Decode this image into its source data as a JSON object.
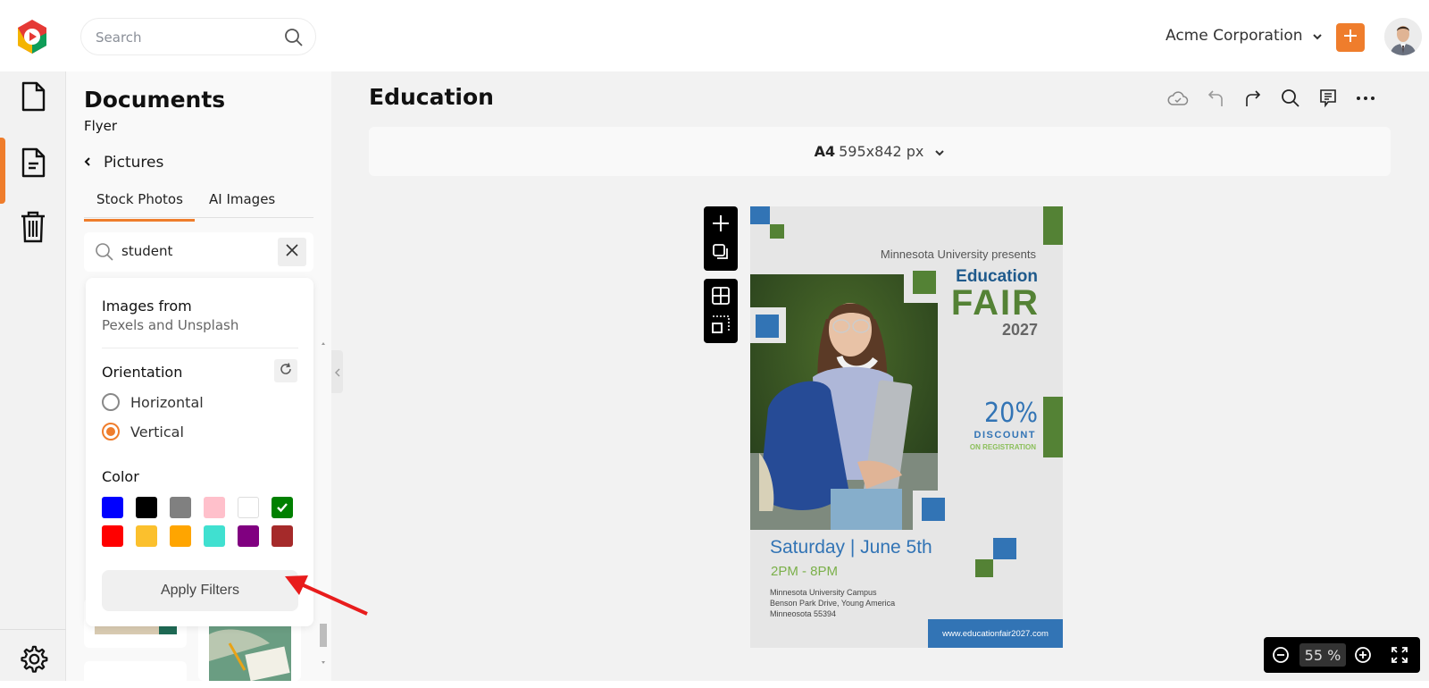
{
  "header": {
    "search_placeholder": "Search",
    "organization": "Acme Corporation",
    "add_label": "+"
  },
  "rail": {
    "items": [
      {
        "name": "documents",
        "icon": "file-icon"
      },
      {
        "name": "templates",
        "icon": "file-text-icon",
        "active": true
      },
      {
        "name": "trash",
        "icon": "trash-icon"
      }
    ],
    "settings_icon": "gear-icon"
  },
  "panel": {
    "title": "Documents",
    "subtitle": "Flyer",
    "back_label": "Pictures",
    "tabs": [
      {
        "label": "Stock Photos",
        "active": true
      },
      {
        "label": "AI Images",
        "active": false
      }
    ],
    "search_value": "student"
  },
  "filters": {
    "source_label": "Images from",
    "source_value": "Pexels and Unsplash",
    "orientation_label": "Orientation",
    "orientation_options": [
      {
        "label": "Horizontal",
        "selected": false
      },
      {
        "label": "Vertical",
        "selected": true
      }
    ],
    "color_label": "Color",
    "colors": [
      {
        "name": "blue",
        "hex": "#0000ff",
        "selected": false
      },
      {
        "name": "black",
        "hex": "#000000",
        "selected": false
      },
      {
        "name": "gray",
        "hex": "#808080",
        "selected": false
      },
      {
        "name": "pink",
        "hex": "#ffc0cb",
        "selected": false
      },
      {
        "name": "white",
        "hex": "#ffffff",
        "selected": false
      },
      {
        "name": "green",
        "hex": "#008000",
        "selected": true
      },
      {
        "name": "red",
        "hex": "#ff0000",
        "selected": false
      },
      {
        "name": "yellow",
        "hex": "#fbc02d",
        "selected": false
      },
      {
        "name": "orange",
        "hex": "#ffa500",
        "selected": false
      },
      {
        "name": "turquoise",
        "hex": "#40e0d0",
        "selected": false
      },
      {
        "name": "purple",
        "hex": "#800080",
        "selected": false
      },
      {
        "name": "brown",
        "hex": "#a52a2a",
        "selected": false
      }
    ],
    "apply_label": "Apply Filters"
  },
  "main": {
    "title": "Education",
    "size_name": "A4",
    "size_dims": "595x842 px",
    "zoom_value": "55",
    "zoom_unit": "%"
  },
  "flyer": {
    "presenter": "Minnesota University presents",
    "title_line1": "Education",
    "title_line2": "FAIR",
    "year": "2027",
    "discount": "20%",
    "discount_label": "DISCOUNT",
    "discount_note": "ON REGISTRATION",
    "date": "Saturday | June 5th",
    "time": "2PM - 8PM",
    "address_line1": "Minnesota University Campus",
    "address_line2": "Benson Park Drive, Young America",
    "address_line3": "Minneosota 55394",
    "website": "www.educationfair2027.com",
    "colors": {
      "blue": "#3274b5",
      "green": "#548235",
      "light_green": "#8bbf5a",
      "bg": "#e6e6e6"
    }
  },
  "colors": {
    "accent": "#ef7d2c"
  }
}
